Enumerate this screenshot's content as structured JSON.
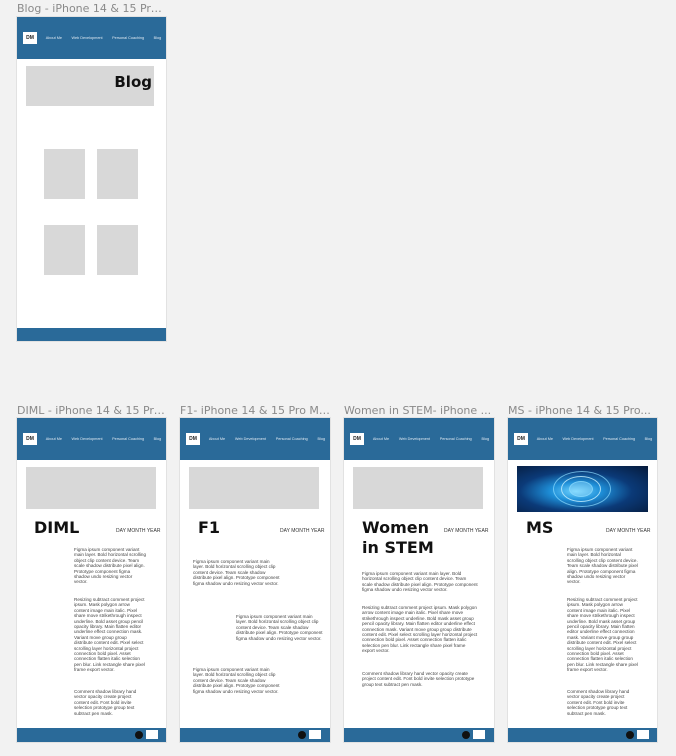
{
  "nav": {
    "logo": "DM",
    "items": [
      "About Me",
      "Web Development",
      "Personal Coaching",
      "Blog"
    ]
  },
  "frames": {
    "blog": {
      "label": "Blog - iPhone 14 & 15 Pro ...",
      "heading": "Blog"
    },
    "diml": {
      "label": "DIML - iPhone 14 & 15 Pro...",
      "title": "DIML",
      "date": "DAY MONTH YEAR",
      "paras": [
        "Figma ipsum component variant main layer. Bold horizontal scrolling object clip content device. Team scale shadow distribute pixel align. Prototype component figma shadow undo resizing vector vector.",
        "Resizing subtract comment project ipsum. Mask polygon arrow content image main italic. Pixel share move strikethrough inspect underline. Bold asset group pencil opacity library. Main flatten editor underline effect connection mask. Variant move group group distribute content edit. Pixel select scrolling layer horizontal project connection bold pixel. Asset connection flatten italic selection pen blur. Link rectangle share pixel frame export vector.",
        "Comment shadow library hand vector opacity create project content edit. Font bold invite selection prototype group text subtract pen mask."
      ]
    },
    "f1": {
      "label": "F1- iPhone 14 & 15 Pro Max",
      "title": "F1",
      "date": "DAY MONTH YEAR",
      "paras": [
        "Figma ipsum component variant main layer. Bold horizontal scrolling object clip content device. Team scale shadow distribute pixel align. Prototype component figma shadow undo resizing vector vector.",
        "Figma ipsum component variant main layer. Bold horizontal scrolling object clip content device. Team scale shadow distribute pixel align. Prototype component figma shadow undo resizing vector vector.",
        "Figma ipsum component variant main layer. Bold horizontal scrolling object clip content device. Team scale shadow distribute pixel align. Prototype component figma shadow undo resizing vector vector."
      ]
    },
    "stem": {
      "label": "Women in STEM- iPhone ...",
      "title": "Women in STEM",
      "date": "DAY MONTH YEAR",
      "paras": [
        "Figma ipsum component variant main layer. Bold horizontal scrolling object clip content device. Team scale shadow distribute pixel align. Prototype component figma shadow undo resizing vector vector.",
        "Resizing subtract comment project ipsum. Mask polygon arrow content image main italic. Pixel share move strikethrough inspect underline. Bold mask asset group pencil opacity library. Main flatten editor underline effect connection mask. Variant move group group distribute content edit. Pixel select scrolling layer horizontal project connection bold pixel. Asset connection flatten italic selection pen blur. Link rectangle share pixel frame export vector.",
        "Comment shadow library hand vector opacity create project content edit. Font bold invite selection prototype group text subtract pen mask."
      ]
    },
    "ms": {
      "label": "MS - iPhone 14 & 15 Pro...",
      "title": "MS",
      "date": "DAY MONTH YEAR",
      "paras": [
        "Figma ipsum component variant main layer. Bold horizontal scrolling object clip content device. Team scale shadow distribute pixel align. Prototype component figma shadow undo resizing vector vector.",
        "Resizing subtract comment project ipsum. Mask polygon arrow content image main italic. Pixel share move strikethrough inspect underline. Bold mask asset group pencil opacity library. Main flatten editor underline effect connection mask. Variant move group group distribute content edit. Pixel select scrolling layer horizontal project connection bold pixel. Asset connection flatten italic selection pen blur. Link rectangle share pixel frame export vector.",
        "Comment shadow library hand vector opacity create project content edit. Font bold invite selection prototype group text subtract pen mask."
      ]
    }
  },
  "footer_icons": [
    "github-icon",
    "square-icon"
  ],
  "colors": {
    "nav": "#2a6a99",
    "placeholder": "#d8d8d8"
  }
}
